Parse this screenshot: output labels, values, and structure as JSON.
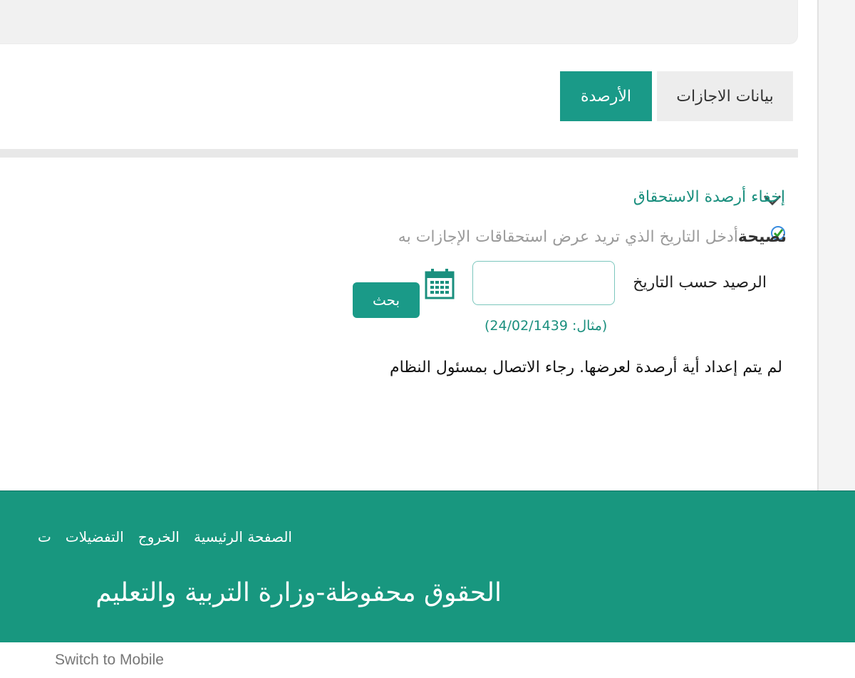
{
  "tabs": {
    "leave_data": "بيانات الاجازات",
    "balances": "الأرصدة"
  },
  "toggle": {
    "label": "إخفاء أرصدة الاستحقاق"
  },
  "tip": {
    "strong": "نصيحة",
    "text": "أدخل التاريخ الذي تريد عرض استحقاقات الإجازات به"
  },
  "form": {
    "date_label": "الرصيد حسب التاريخ",
    "date_value": "",
    "search_label": "بحث",
    "example": "(مثال: 24/02/1439)"
  },
  "message": "لم يتم إعداد أية أرصدة لعرضها. رجاء الاتصال بمسئول النظام",
  "footer": {
    "links": [
      "الصفحة الرئيسية",
      "الخروج",
      "التفضيلات",
      "ت"
    ],
    "copyright": "الحقوق محفوظة-وزارة التربية والتعليم"
  },
  "switch_mobile": "Switch to Mobile",
  "icons": {
    "toggle": "chevron-down-icon",
    "tip": "check-badge-icon",
    "calendar": "calendar-icon"
  },
  "colors": {
    "accent": "#1a9a88",
    "footer": "#18977f"
  }
}
